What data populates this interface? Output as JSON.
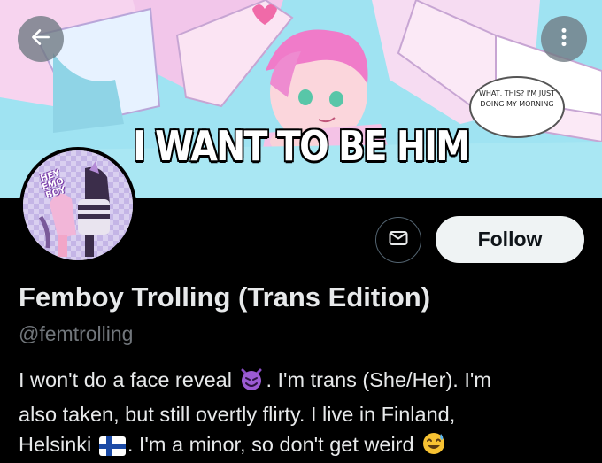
{
  "banner": {
    "caption": "I WANT TO BE HIM",
    "speech_bubble": "WHAT, THIS? I'M JUST DOING MY MORNING"
  },
  "avatar": {
    "label": "HEY EMO BOY"
  },
  "profile": {
    "display_name": "Femboy Trolling (Trans Edition)",
    "handle": "@femtrolling",
    "follow_label": "Follow",
    "bio": {
      "line1_a": "I won't do a face reveal",
      "line1_b": ". I'm trans (She/Her). I'm",
      "line2": "also taken, but still overtly flirty. I live in Finland,",
      "line3_a": "Helsinki",
      "line3_b": ". I'm a minor, so don't get weird"
    }
  },
  "icons": {
    "back": "arrow-left-icon",
    "more": "more-vertical-icon",
    "message": "envelope-icon",
    "emoji_devil": "smiling-devil-emoji",
    "emoji_flag": "finland-flag-emoji",
    "emoji_sweat": "grinning-sweat-emoji"
  },
  "colors": {
    "background": "#000000",
    "text_primary": "#e7e9ea",
    "text_secondary": "#71767b",
    "follow_button": "#eff3f4",
    "banner_sky": "#9fe3f2"
  }
}
